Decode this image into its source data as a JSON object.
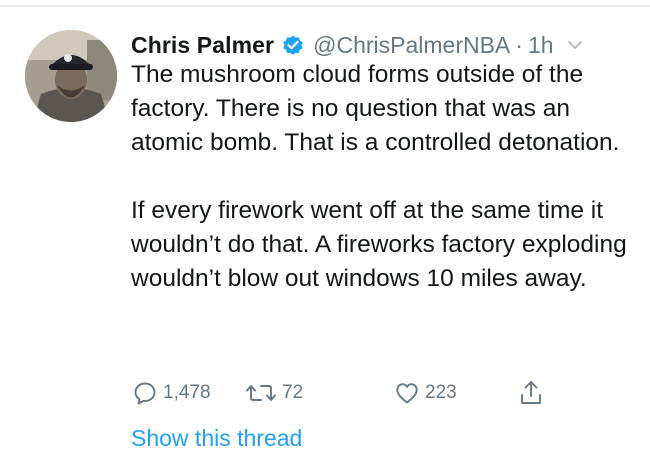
{
  "tweet": {
    "author_name": "Chris Palmer",
    "handle": "@ChrisPalmerNBA",
    "separator": "·",
    "time": "1h",
    "paragraphs": [
      "The mushroom cloud forms outside of the factory. There is no question that was an atomic bomb. That is a controlled detonation.",
      "If every firework went off at the same time it wouldn’t do that. A fireworks factory exploding wouldn’t blow out windows 10 miles away."
    ],
    "actions": {
      "replies": "1,478",
      "retweets": "72",
      "likes": "223"
    },
    "show_thread_label": "Show this thread"
  },
  "icons": {
    "verified": "verified-badge-icon",
    "caret": "chevron-down-icon",
    "reply": "reply-icon",
    "retweet": "retweet-icon",
    "like": "heart-icon",
    "share": "share-icon"
  },
  "colors": {
    "text": "#14171a",
    "secondary": "#657786",
    "link": "#1da1f2",
    "verified": "#1da1f2"
  }
}
